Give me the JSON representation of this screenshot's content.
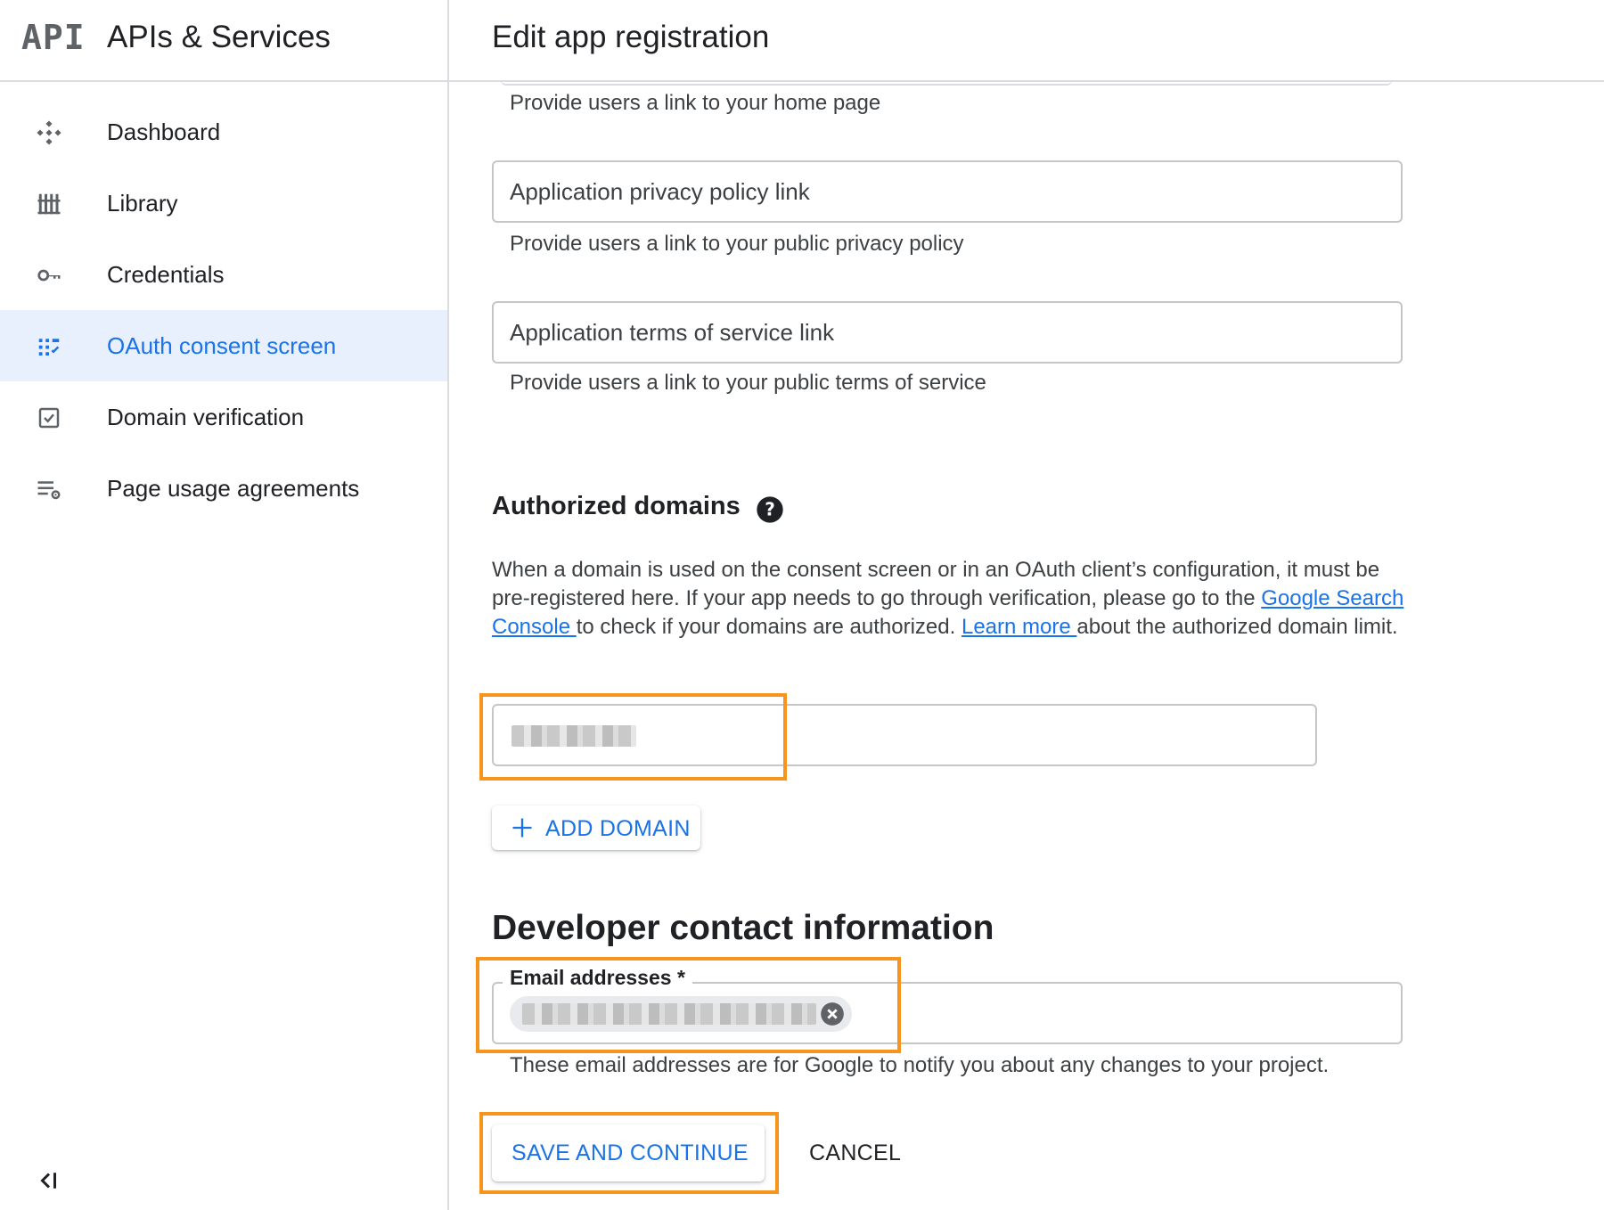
{
  "sidebar": {
    "logo": "API",
    "product_title": "APIs & Services",
    "items": [
      {
        "label": "Dashboard",
        "icon": "dashboard-icon"
      },
      {
        "label": "Library",
        "icon": "library-icon"
      },
      {
        "label": "Credentials",
        "icon": "key-icon"
      },
      {
        "label": "OAuth consent screen",
        "icon": "consent-icon",
        "active": true
      },
      {
        "label": "Domain verification",
        "icon": "checkbox-icon"
      },
      {
        "label": "Page usage agreements",
        "icon": "settings-list-icon"
      }
    ],
    "collapse_icon": "collapse-icon"
  },
  "header": {
    "title": "Edit app registration"
  },
  "form": {
    "home_page_hint": "Provide users a link to your home page",
    "privacy": {
      "placeholder": "Application privacy policy link",
      "hint": "Provide users a link to your public privacy policy"
    },
    "terms": {
      "placeholder": "Application terms of service link",
      "hint": "Provide users a link to your public terms of service"
    },
    "authorized_domains": {
      "title": "Authorized domains",
      "para_1": "When a domain is used on the consent screen or in an OAuth client’s configuration, it must be pre-registered here. If your app needs to go through verification, please go to the ",
      "link_1": "Google Search Console ",
      "para_2": "to check if your domains are authorized. ",
      "link_2": "Learn more ",
      "para_3": "about the authorized domain limit.",
      "add_domain_label": "ADD DOMAIN"
    },
    "developer_contact": {
      "title": "Developer contact information",
      "email_label": "Email addresses *",
      "hint": "These email addresses are for Google to notify you about any changes to your project."
    },
    "save_label": "SAVE AND CONTINUE",
    "cancel_label": "CANCEL"
  },
  "colors": {
    "accent": "#1a73e8",
    "active_bg": "#e8f0fe",
    "highlight": "#f7941d"
  }
}
